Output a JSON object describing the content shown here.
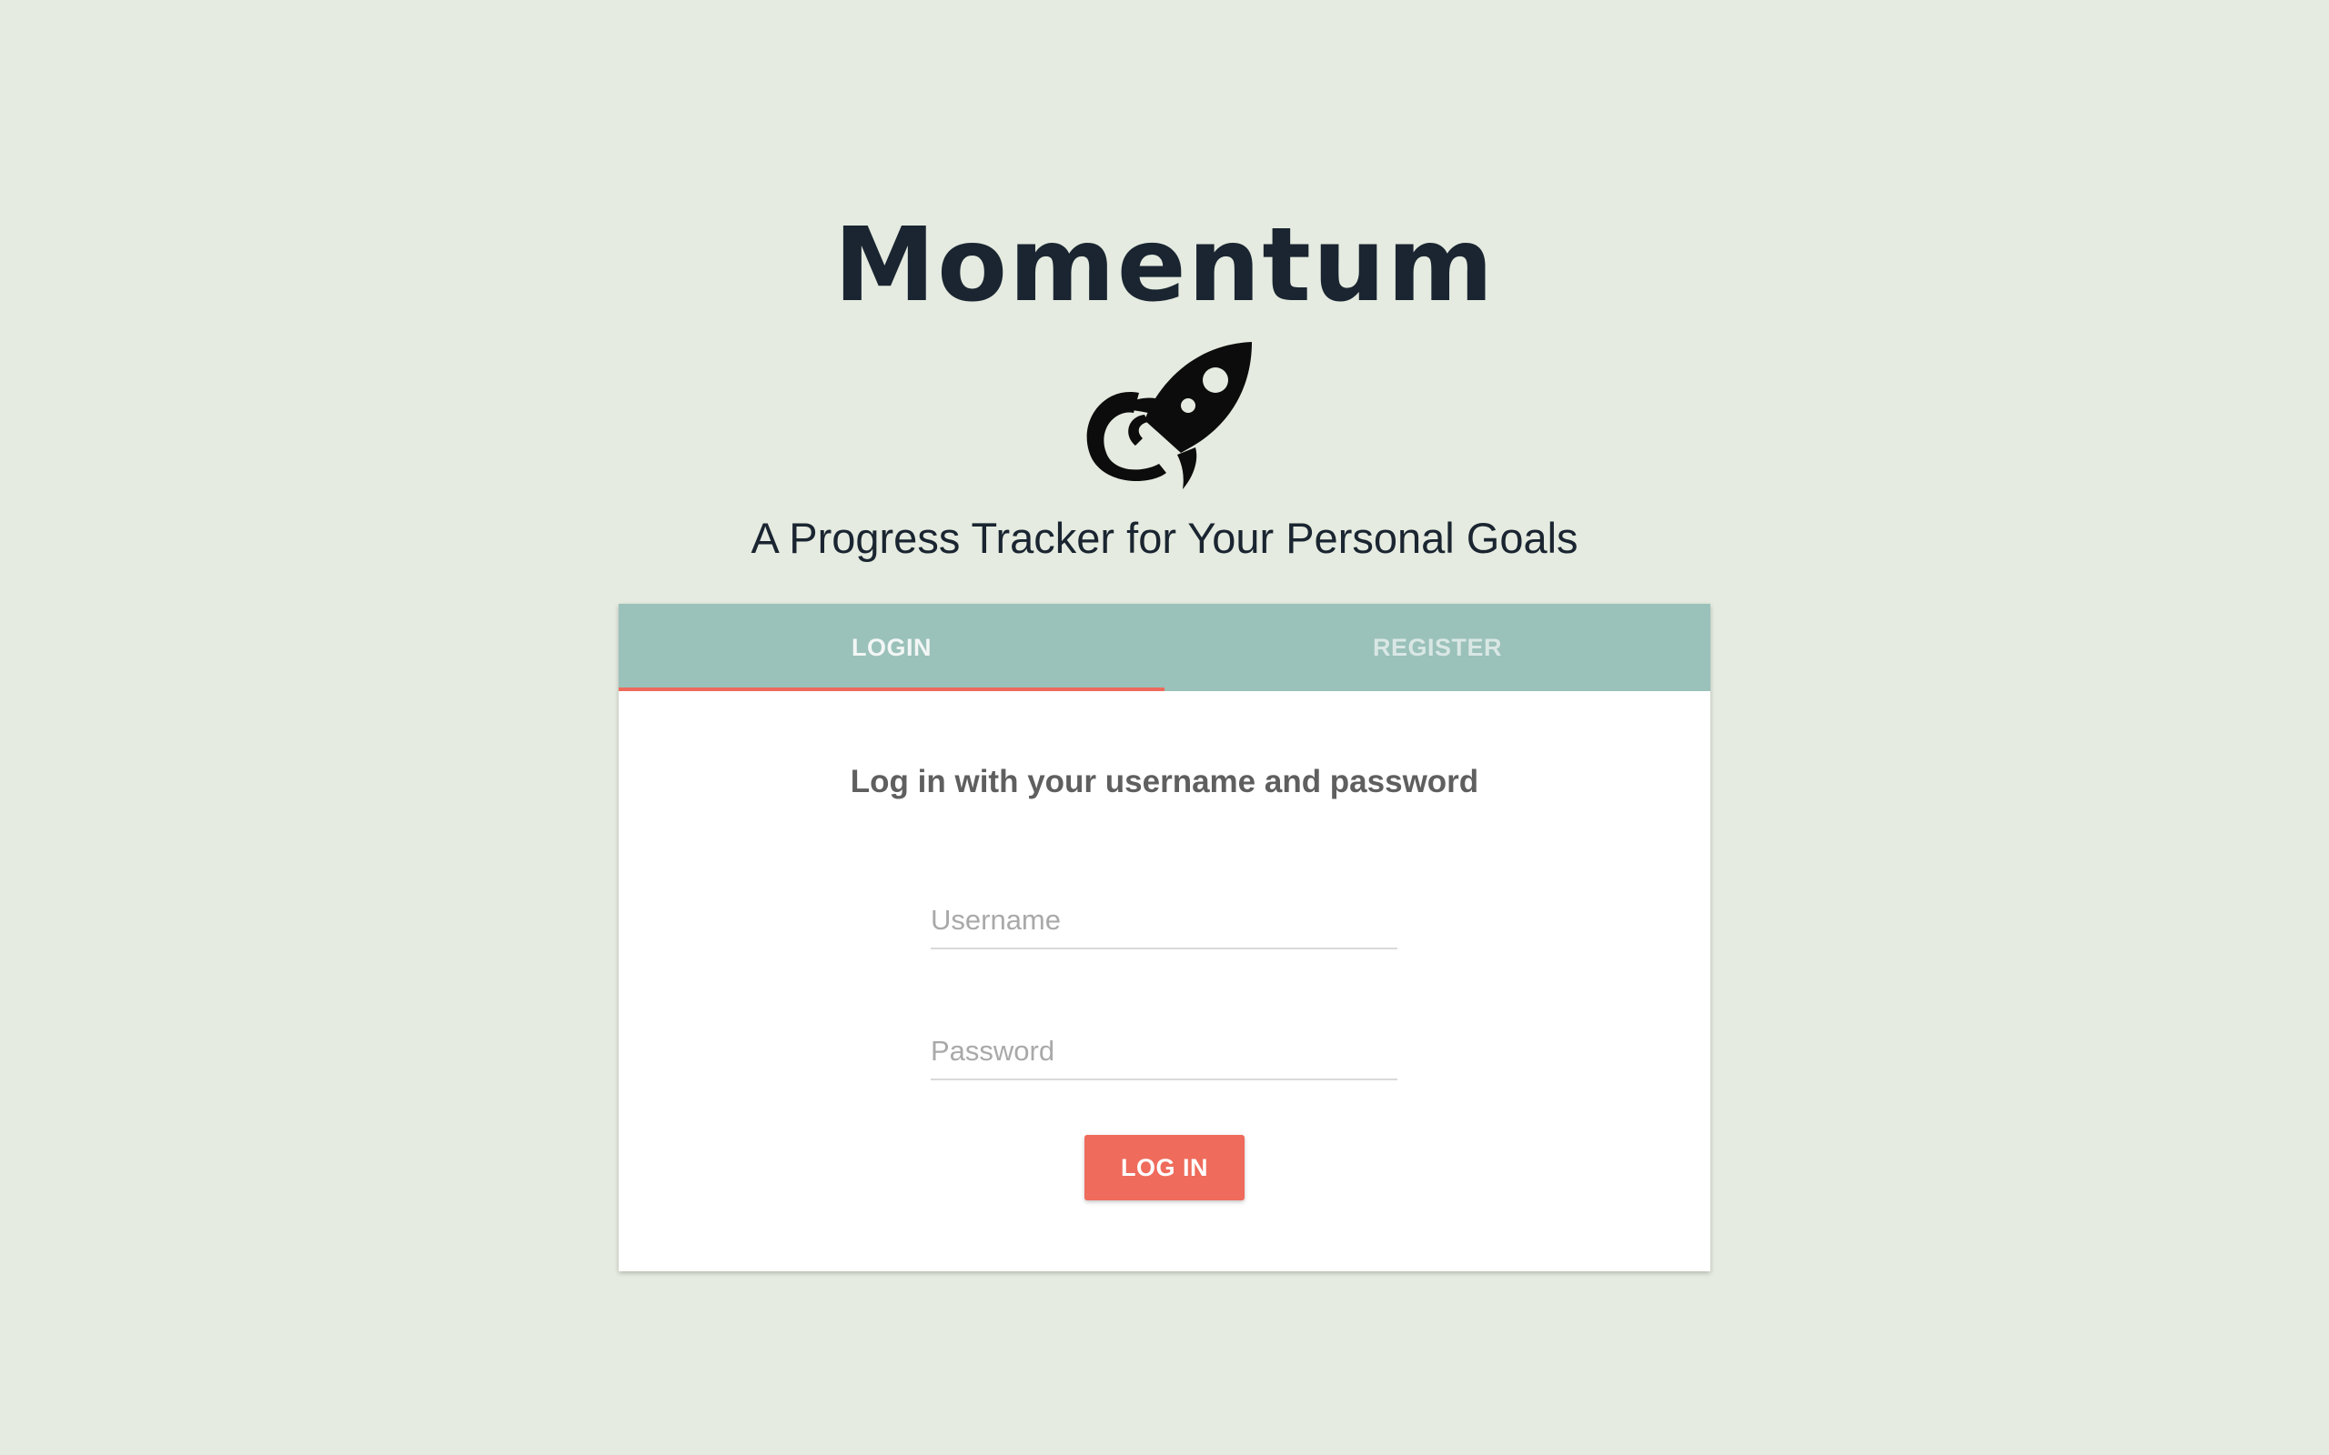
{
  "brand": {
    "title": "Momentum",
    "logo_icon": "rocket-icon",
    "tagline": "A Progress Tracker for Your Personal Goals"
  },
  "tabs": [
    {
      "label": "LOGIN",
      "active": true
    },
    {
      "label": "REGISTER",
      "active": false
    }
  ],
  "login_form": {
    "heading": "Log in with your username and password",
    "username": {
      "value": "",
      "placeholder": "Username"
    },
    "password": {
      "value": "",
      "placeholder": "Password"
    },
    "submit_label": "LOG IN"
  },
  "colors": {
    "background": "#e5ebe0",
    "tab_bar": "#9ac1ba",
    "accent": "#ef6b5c",
    "title_text": "#1a2531"
  }
}
